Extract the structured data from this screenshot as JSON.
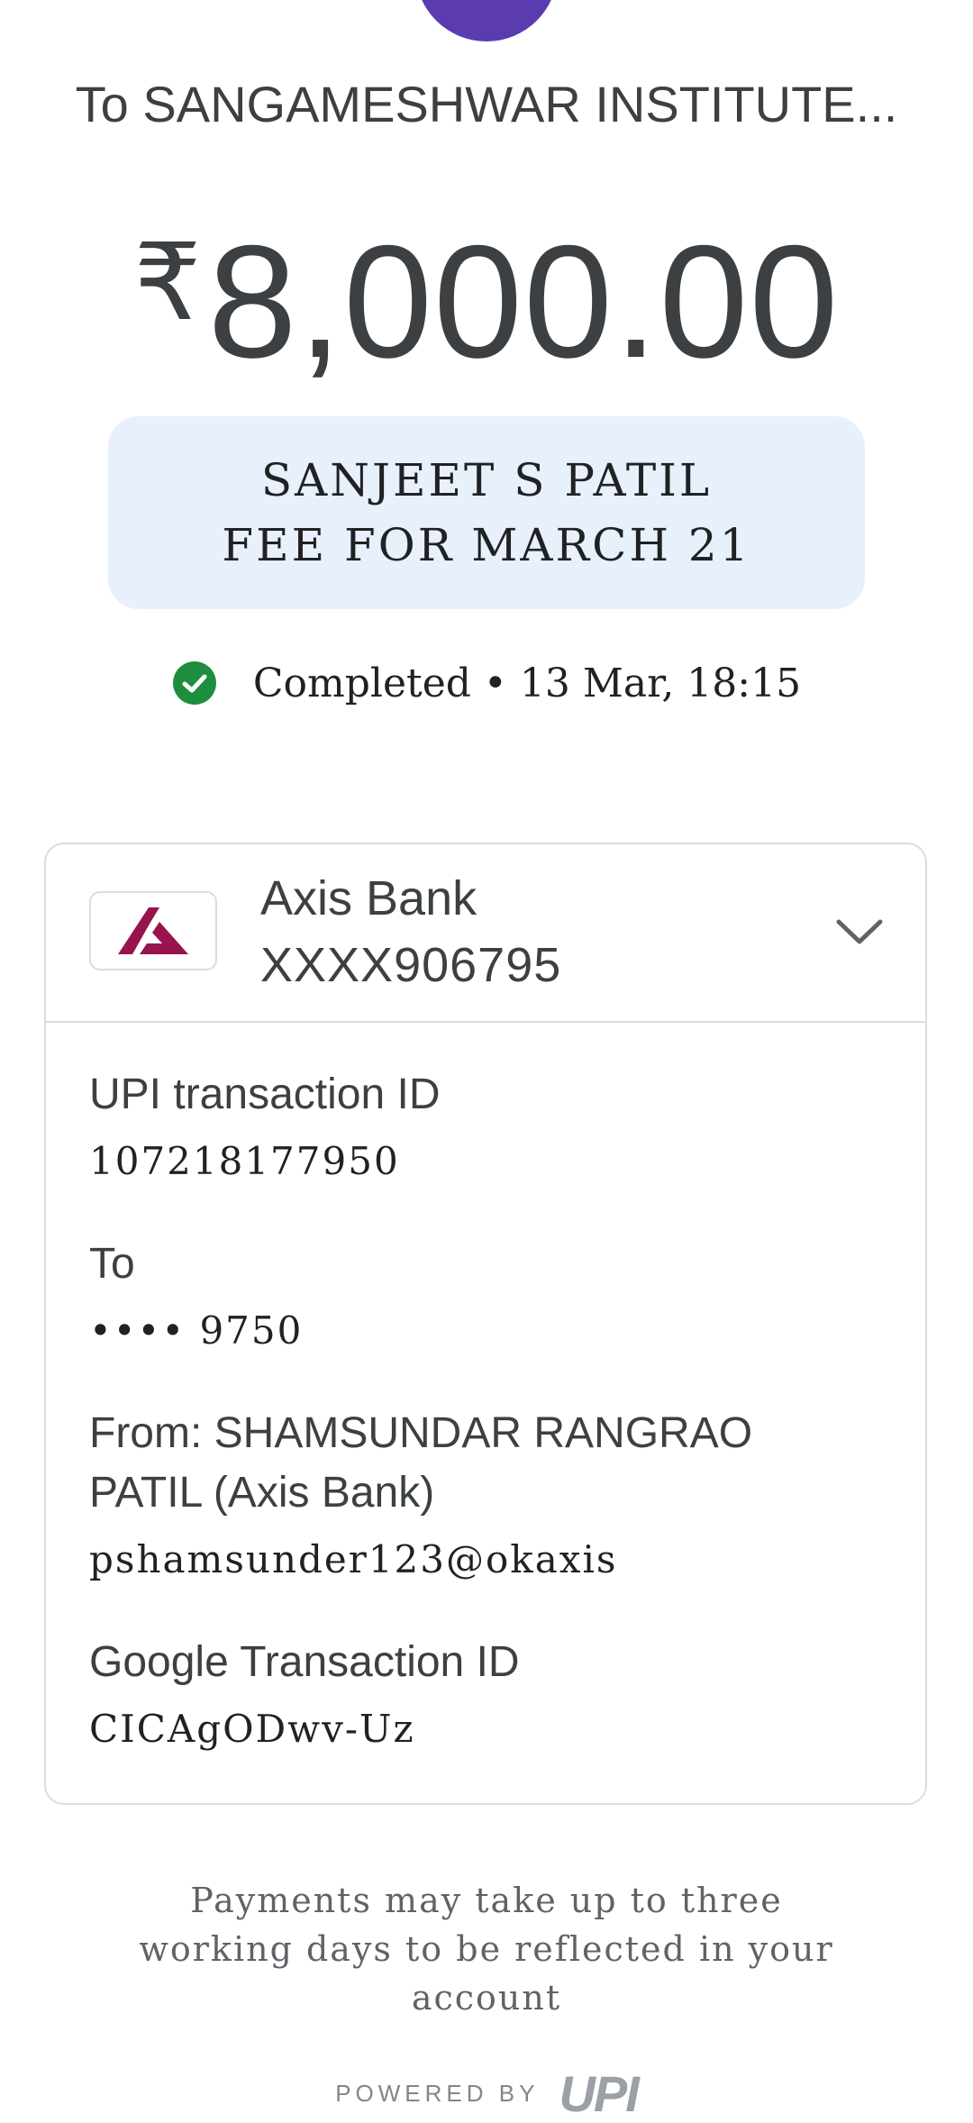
{
  "header": {
    "recipient": "To SANGAMESHWAR INSTITUTE...",
    "amount_currency": "₹",
    "amount_value": "8,000.00"
  },
  "note": {
    "line1": "SANJEET S PATIL",
    "line2": "FEE FOR MARCH 21"
  },
  "status": {
    "icon": "check-circle-icon",
    "text": "Completed • 13 Mar, 18:15",
    "color": "#1e8e3e"
  },
  "bank": {
    "logo_icon": "axis-bank-logo-icon",
    "name": "Axis Bank",
    "account": "XXXX906795",
    "expand_icon": "chevron-down-icon",
    "brand_color": "#97144d"
  },
  "details": {
    "upi_id_label": "UPI transaction ID",
    "upi_id_value": "107218177950",
    "to_label": "To",
    "to_value": "•••• 9750",
    "from_label_line1": "From: SHAMSUNDAR RANGRAO",
    "from_label_line2": "PATIL (Axis Bank)",
    "from_value": "pshamsunder123@okaxis",
    "google_id_label": "Google Transaction ID",
    "google_id_value": "CICAgODwv-Uz"
  },
  "footer": {
    "note": "Payments may take up to three working days to be reflected in your account",
    "powered_by": "POWERED BY",
    "upi_logo": "UPI"
  },
  "colors": {
    "note_bg": "#e8f0fc",
    "avatar": "#5b3bb0"
  }
}
